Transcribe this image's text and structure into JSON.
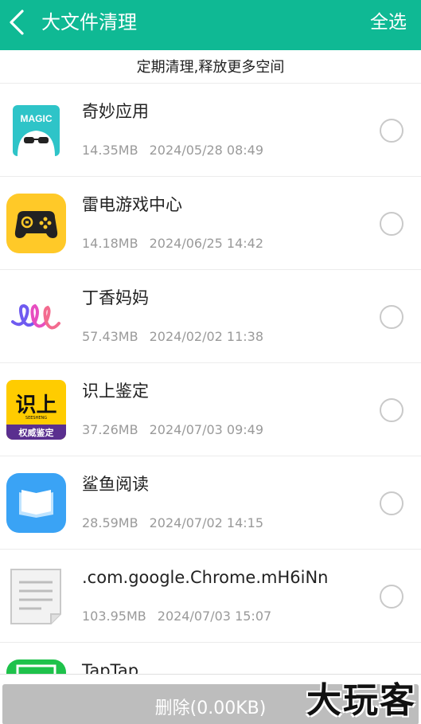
{
  "header": {
    "back_icon": "chevron-left-icon",
    "title": "大文件清理",
    "select_all": "全选",
    "bg_color": "#0fb994"
  },
  "subtitle": "定期清理,释放更多空间",
  "items": [
    {
      "name": "奇妙应用",
      "size": "14.35MB",
      "date": "2024/05/28 08:49",
      "icon": "magic-app-icon",
      "icon_text": "MAGIC",
      "checked": false
    },
    {
      "name": "雷电游戏中心",
      "size": "14.18MB",
      "date": "2024/06/25 14:42",
      "icon": "gamepad-icon",
      "checked": false
    },
    {
      "name": "丁香妈妈",
      "size": "57.43MB",
      "date": "2024/02/02 11:38",
      "icon": "dingxiang-logo-icon",
      "checked": false
    },
    {
      "name": "识上鉴定",
      "size": "37.26MB",
      "date": "2024/07/03 09:49",
      "icon": "shishang-logo-icon",
      "icon_text": "识上",
      "icon_subtext": "SEESHENG",
      "icon_badge": "权威鉴定",
      "checked": false
    },
    {
      "name": "鲨鱼阅读",
      "size": "28.59MB",
      "date": "2024/07/02 14:15",
      "icon": "book-icon",
      "checked": false
    },
    {
      "name": ".com.google.Chrome.mH6iNn",
      "size": "103.95MB",
      "date": "2024/07/03 15:07",
      "icon": "document-file-icon",
      "checked": false
    },
    {
      "name": "TapTap",
      "size": "",
      "date": "",
      "icon": "taptap-icon",
      "checked": false
    }
  ],
  "delete_button": "删除(0.00KB)",
  "watermark": "大玩客"
}
